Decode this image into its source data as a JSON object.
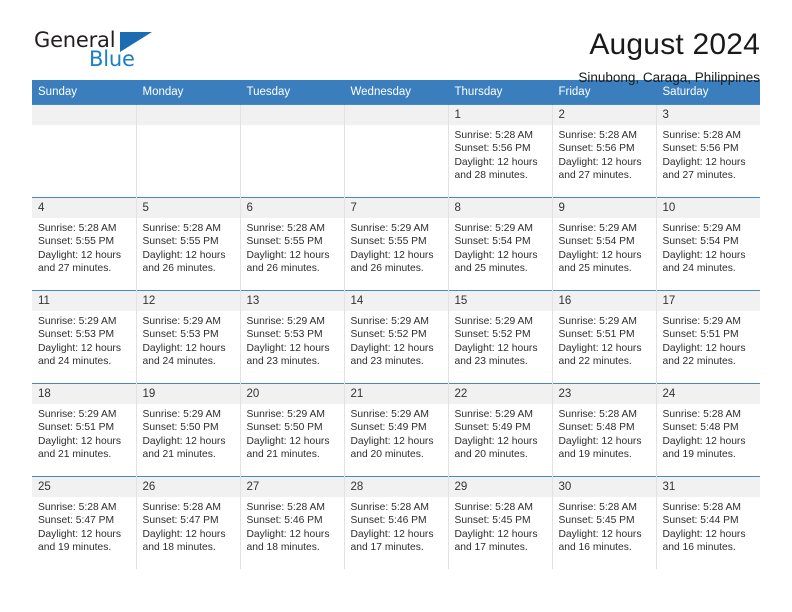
{
  "brand": {
    "name_top": "General",
    "name_bottom": "Blue",
    "top_color": "#231f20",
    "bottom_color": "#1b7fc3",
    "triangle_color": "#1b6cb0"
  },
  "header": {
    "title": "August 2024",
    "location": "Sinubong, Caraga, Philippines"
  },
  "theme": {
    "header_bg": "#3b7ebd",
    "header_text": "#ffffff",
    "daynum_bg": "#f1f1f1",
    "row_divider": "#4a88c4",
    "cell_border": "#e2e2e2"
  },
  "weekdays": [
    "Sunday",
    "Monday",
    "Tuesday",
    "Wednesday",
    "Thursday",
    "Friday",
    "Saturday"
  ],
  "weeks": [
    [
      {
        "blank": true
      },
      {
        "blank": true
      },
      {
        "blank": true
      },
      {
        "blank": true
      },
      {
        "day": "1",
        "sunrise": "Sunrise: 5:28 AM",
        "sunset": "Sunset: 5:56 PM",
        "daylight1": "Daylight: 12 hours",
        "daylight2": "and 28 minutes."
      },
      {
        "day": "2",
        "sunrise": "Sunrise: 5:28 AM",
        "sunset": "Sunset: 5:56 PM",
        "daylight1": "Daylight: 12 hours",
        "daylight2": "and 27 minutes."
      },
      {
        "day": "3",
        "sunrise": "Sunrise: 5:28 AM",
        "sunset": "Sunset: 5:56 PM",
        "daylight1": "Daylight: 12 hours",
        "daylight2": "and 27 minutes."
      }
    ],
    [
      {
        "day": "4",
        "sunrise": "Sunrise: 5:28 AM",
        "sunset": "Sunset: 5:55 PM",
        "daylight1": "Daylight: 12 hours",
        "daylight2": "and 27 minutes."
      },
      {
        "day": "5",
        "sunrise": "Sunrise: 5:28 AM",
        "sunset": "Sunset: 5:55 PM",
        "daylight1": "Daylight: 12 hours",
        "daylight2": "and 26 minutes."
      },
      {
        "day": "6",
        "sunrise": "Sunrise: 5:28 AM",
        "sunset": "Sunset: 5:55 PM",
        "daylight1": "Daylight: 12 hours",
        "daylight2": "and 26 minutes."
      },
      {
        "day": "7",
        "sunrise": "Sunrise: 5:29 AM",
        "sunset": "Sunset: 5:55 PM",
        "daylight1": "Daylight: 12 hours",
        "daylight2": "and 26 minutes."
      },
      {
        "day": "8",
        "sunrise": "Sunrise: 5:29 AM",
        "sunset": "Sunset: 5:54 PM",
        "daylight1": "Daylight: 12 hours",
        "daylight2": "and 25 minutes."
      },
      {
        "day": "9",
        "sunrise": "Sunrise: 5:29 AM",
        "sunset": "Sunset: 5:54 PM",
        "daylight1": "Daylight: 12 hours",
        "daylight2": "and 25 minutes."
      },
      {
        "day": "10",
        "sunrise": "Sunrise: 5:29 AM",
        "sunset": "Sunset: 5:54 PM",
        "daylight1": "Daylight: 12 hours",
        "daylight2": "and 24 minutes."
      }
    ],
    [
      {
        "day": "11",
        "sunrise": "Sunrise: 5:29 AM",
        "sunset": "Sunset: 5:53 PM",
        "daylight1": "Daylight: 12 hours",
        "daylight2": "and 24 minutes."
      },
      {
        "day": "12",
        "sunrise": "Sunrise: 5:29 AM",
        "sunset": "Sunset: 5:53 PM",
        "daylight1": "Daylight: 12 hours",
        "daylight2": "and 24 minutes."
      },
      {
        "day": "13",
        "sunrise": "Sunrise: 5:29 AM",
        "sunset": "Sunset: 5:53 PM",
        "daylight1": "Daylight: 12 hours",
        "daylight2": "and 23 minutes."
      },
      {
        "day": "14",
        "sunrise": "Sunrise: 5:29 AM",
        "sunset": "Sunset: 5:52 PM",
        "daylight1": "Daylight: 12 hours",
        "daylight2": "and 23 minutes."
      },
      {
        "day": "15",
        "sunrise": "Sunrise: 5:29 AM",
        "sunset": "Sunset: 5:52 PM",
        "daylight1": "Daylight: 12 hours",
        "daylight2": "and 23 minutes."
      },
      {
        "day": "16",
        "sunrise": "Sunrise: 5:29 AM",
        "sunset": "Sunset: 5:51 PM",
        "daylight1": "Daylight: 12 hours",
        "daylight2": "and 22 minutes."
      },
      {
        "day": "17",
        "sunrise": "Sunrise: 5:29 AM",
        "sunset": "Sunset: 5:51 PM",
        "daylight1": "Daylight: 12 hours",
        "daylight2": "and 22 minutes."
      }
    ],
    [
      {
        "day": "18",
        "sunrise": "Sunrise: 5:29 AM",
        "sunset": "Sunset: 5:51 PM",
        "daylight1": "Daylight: 12 hours",
        "daylight2": "and 21 minutes."
      },
      {
        "day": "19",
        "sunrise": "Sunrise: 5:29 AM",
        "sunset": "Sunset: 5:50 PM",
        "daylight1": "Daylight: 12 hours",
        "daylight2": "and 21 minutes."
      },
      {
        "day": "20",
        "sunrise": "Sunrise: 5:29 AM",
        "sunset": "Sunset: 5:50 PM",
        "daylight1": "Daylight: 12 hours",
        "daylight2": "and 21 minutes."
      },
      {
        "day": "21",
        "sunrise": "Sunrise: 5:29 AM",
        "sunset": "Sunset: 5:49 PM",
        "daylight1": "Daylight: 12 hours",
        "daylight2": "and 20 minutes."
      },
      {
        "day": "22",
        "sunrise": "Sunrise: 5:29 AM",
        "sunset": "Sunset: 5:49 PM",
        "daylight1": "Daylight: 12 hours",
        "daylight2": "and 20 minutes."
      },
      {
        "day": "23",
        "sunrise": "Sunrise: 5:28 AM",
        "sunset": "Sunset: 5:48 PM",
        "daylight1": "Daylight: 12 hours",
        "daylight2": "and 19 minutes."
      },
      {
        "day": "24",
        "sunrise": "Sunrise: 5:28 AM",
        "sunset": "Sunset: 5:48 PM",
        "daylight1": "Daylight: 12 hours",
        "daylight2": "and 19 minutes."
      }
    ],
    [
      {
        "day": "25",
        "sunrise": "Sunrise: 5:28 AM",
        "sunset": "Sunset: 5:47 PM",
        "daylight1": "Daylight: 12 hours",
        "daylight2": "and 19 minutes."
      },
      {
        "day": "26",
        "sunrise": "Sunrise: 5:28 AM",
        "sunset": "Sunset: 5:47 PM",
        "daylight1": "Daylight: 12 hours",
        "daylight2": "and 18 minutes."
      },
      {
        "day": "27",
        "sunrise": "Sunrise: 5:28 AM",
        "sunset": "Sunset: 5:46 PM",
        "daylight1": "Daylight: 12 hours",
        "daylight2": "and 18 minutes."
      },
      {
        "day": "28",
        "sunrise": "Sunrise: 5:28 AM",
        "sunset": "Sunset: 5:46 PM",
        "daylight1": "Daylight: 12 hours",
        "daylight2": "and 17 minutes."
      },
      {
        "day": "29",
        "sunrise": "Sunrise: 5:28 AM",
        "sunset": "Sunset: 5:45 PM",
        "daylight1": "Daylight: 12 hours",
        "daylight2": "and 17 minutes."
      },
      {
        "day": "30",
        "sunrise": "Sunrise: 5:28 AM",
        "sunset": "Sunset: 5:45 PM",
        "daylight1": "Daylight: 12 hours",
        "daylight2": "and 16 minutes."
      },
      {
        "day": "31",
        "sunrise": "Sunrise: 5:28 AM",
        "sunset": "Sunset: 5:44 PM",
        "daylight1": "Daylight: 12 hours",
        "daylight2": "and 16 minutes."
      }
    ]
  ]
}
